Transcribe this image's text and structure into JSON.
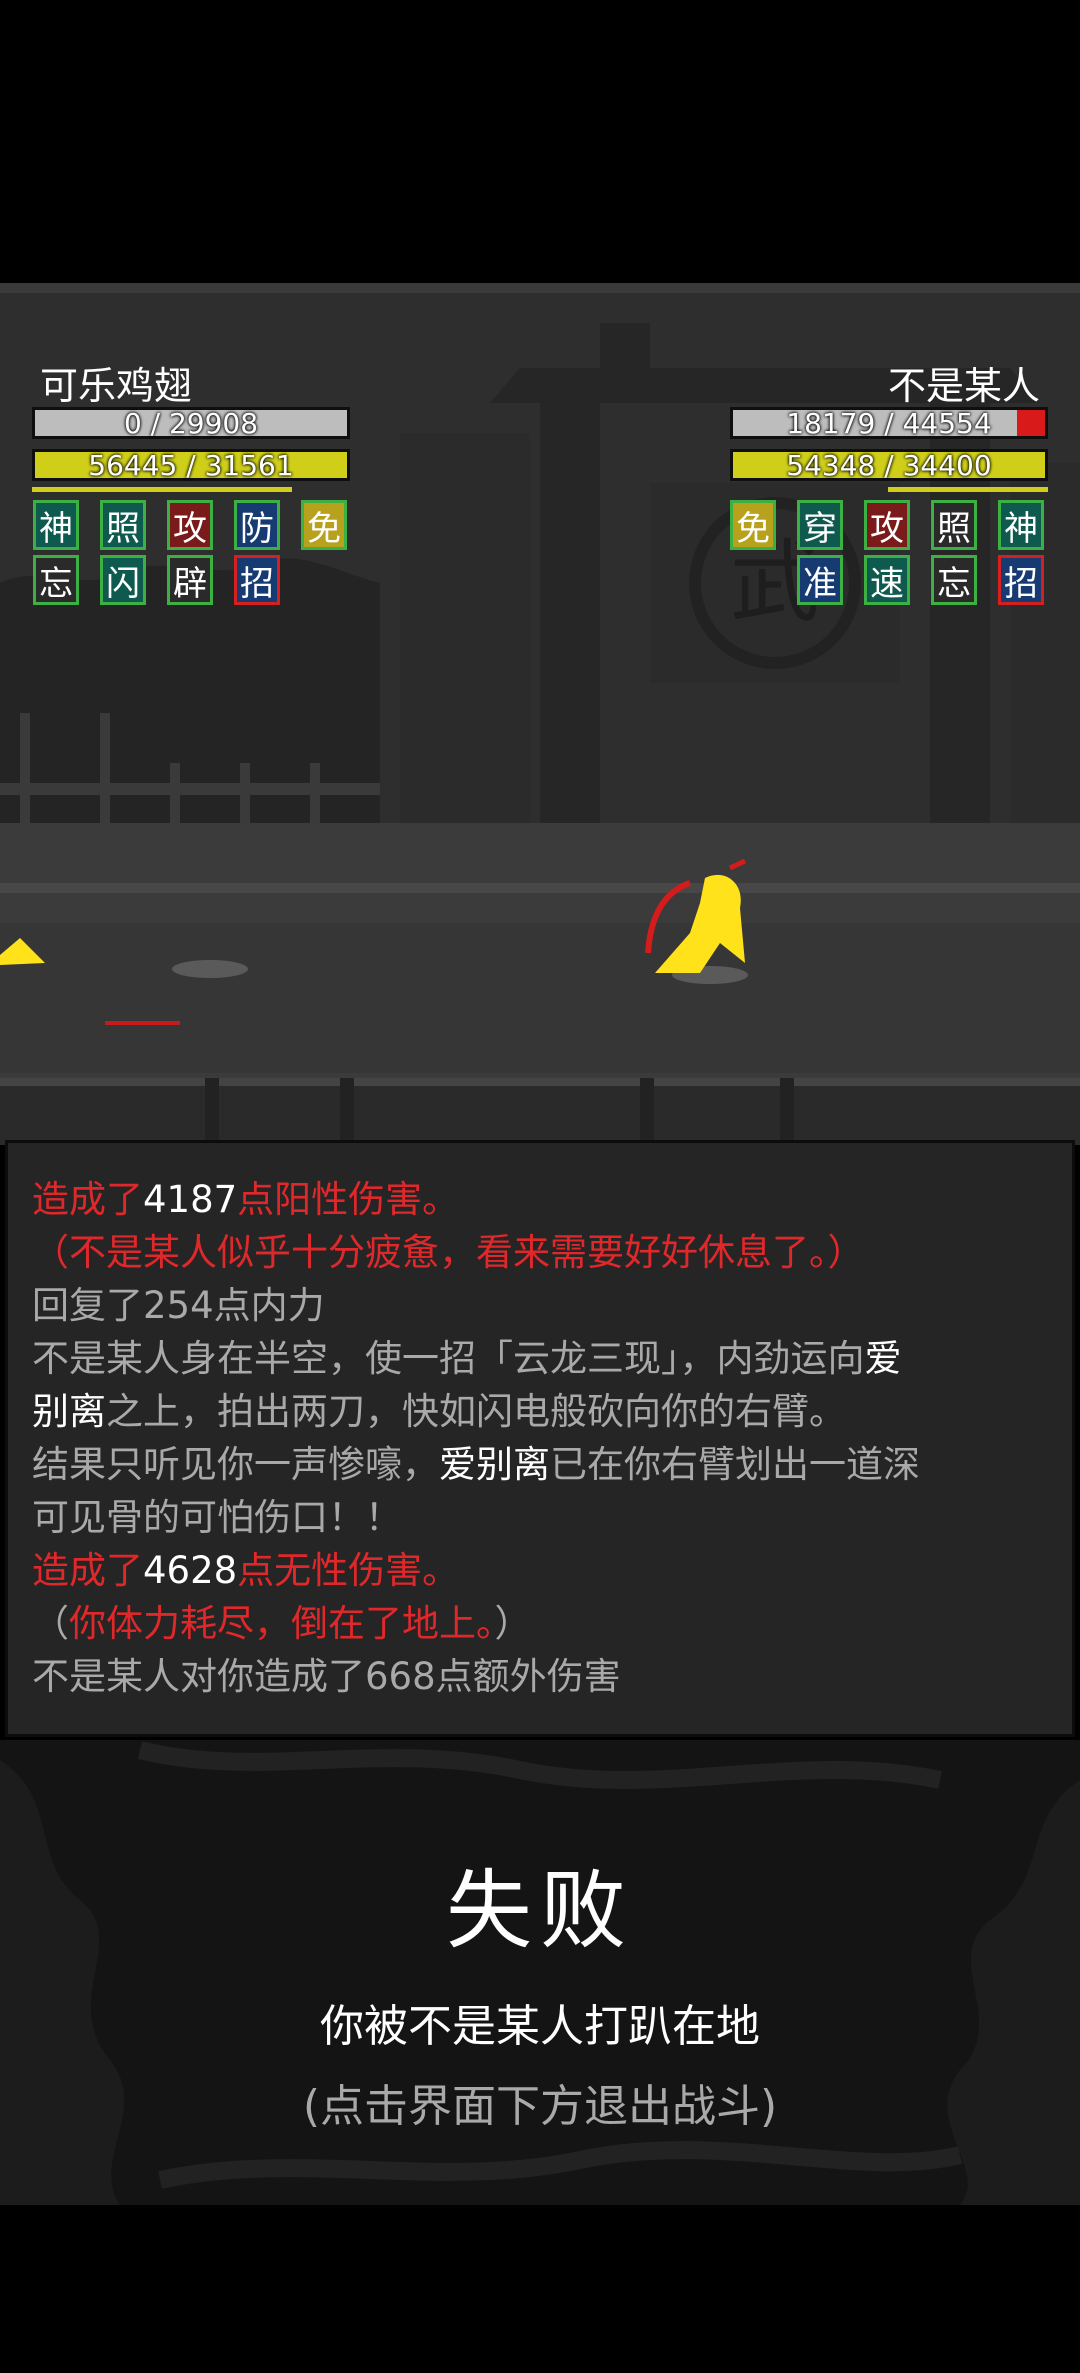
{
  "player": {
    "name": "可乐鸡翅",
    "hp": "0 / 29908",
    "hp_fraction": 0,
    "mp": "56445 / 31561",
    "mp_fraction": 1.0,
    "badges_row1": [
      "神",
      "照",
      "攻",
      "防",
      "免"
    ],
    "badges_row2": [
      "忘",
      "闪",
      "辟",
      "招"
    ]
  },
  "enemy": {
    "name": "不是某人",
    "hp": "18179 / 44554",
    "hp_fraction": 0.41,
    "mp": "54348 / 34400",
    "mp_fraction": 1.0,
    "badges_row1": [
      "免",
      "穿",
      "攻",
      "照",
      "神"
    ],
    "badges_row2": [
      "准",
      "速",
      "忘",
      "招"
    ]
  },
  "scene": {
    "gate_emblem": "武"
  },
  "log": {
    "l1_a": "造成了",
    "l1_b": "4187",
    "l1_c": "点阳性伤害。",
    "l2": "（不是某人似乎十分疲惫，看来需要好好休息了。）",
    "l3": "回复了254点内力",
    "l4_a": "不是某人身在半空，使一招「云龙三现」，内劲运向",
    "l4_b": "爱",
    "l5_a": "别离",
    "l5_b": "之上，拍出两刀，快如闪电般砍向你的右臂。",
    "l6_a": "结果只听见你一声惨嚎，",
    "l6_b": "爱别离",
    "l6_c": "已在你右臂划出一道深",
    "l7": "可见骨的可怕伤口！！",
    "l8_a": "造成了",
    "l8_b": "4628",
    "l8_c": "点无性伤害。",
    "l9_a": "（",
    "l9_b": "你体力耗尽，倒在了地上。",
    "l9_c": "）",
    "l10": "不是某人对你造成了668点额外伤害"
  },
  "result": {
    "title": "失败",
    "subtitle": "你被不是某人打趴在地",
    "hint": "(点击界面下方退出战斗)"
  },
  "colors": {
    "log_red": "#e0282b",
    "bar_yellow": "#cfcf1a",
    "hp_red": "#d91a1a"
  }
}
